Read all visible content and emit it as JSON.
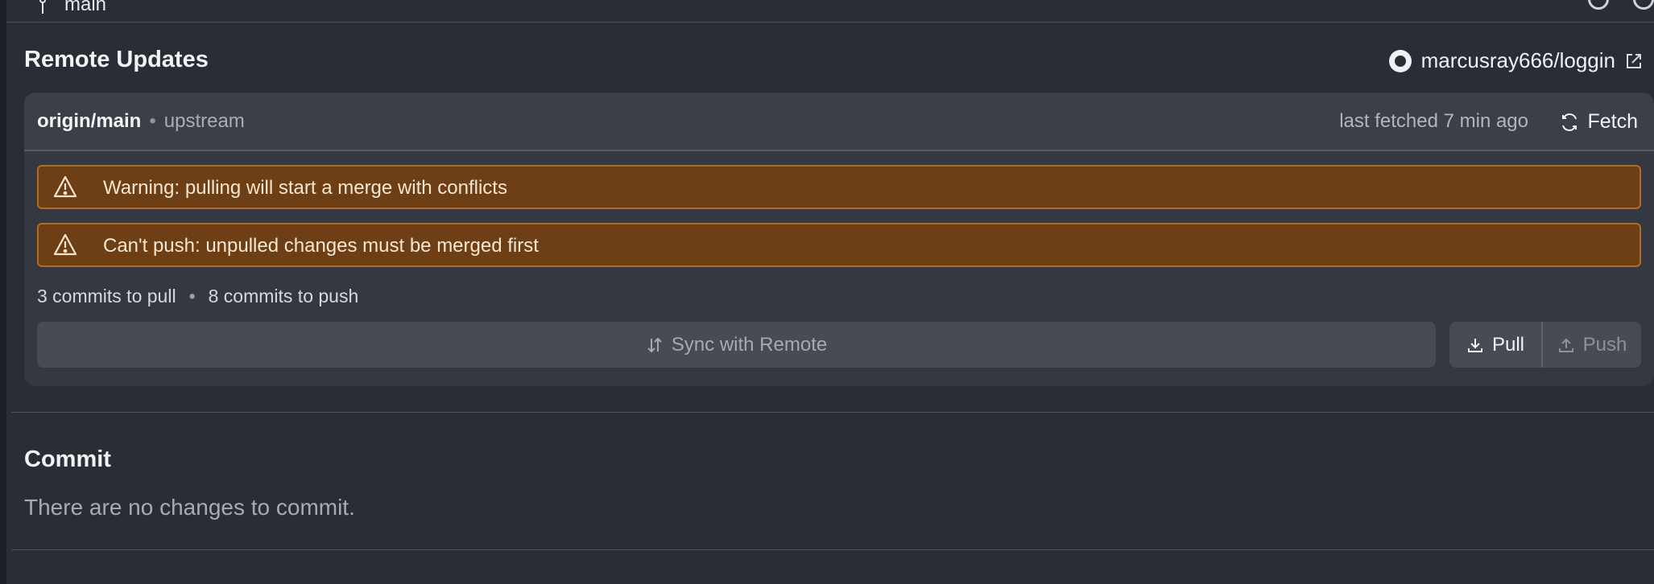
{
  "top": {
    "branch": "main"
  },
  "remote": {
    "title": "Remote Updates",
    "repo": "marcusray666/loggin",
    "ref": "origin/main",
    "ref_separator": "•",
    "ref_kind": "upstream",
    "last_fetched": "last fetched 7 min ago",
    "fetch_label": "Fetch",
    "warnings": [
      "Warning: pulling will start a merge with conflicts",
      "Can't push: unpulled changes must be merged first"
    ],
    "commits_to_pull": "3 commits to pull",
    "count_separator": "•",
    "commits_to_push": "8 commits to push",
    "sync_label": "Sync with Remote",
    "pull_label": "Pull",
    "push_label": "Push"
  },
  "commit": {
    "title": "Commit",
    "empty_message": "There are no changes to commit."
  },
  "colors": {
    "background": "#2a2d35",
    "card": "#353840",
    "warning_bg": "#6e3f14",
    "warning_border": "#b36a22"
  }
}
